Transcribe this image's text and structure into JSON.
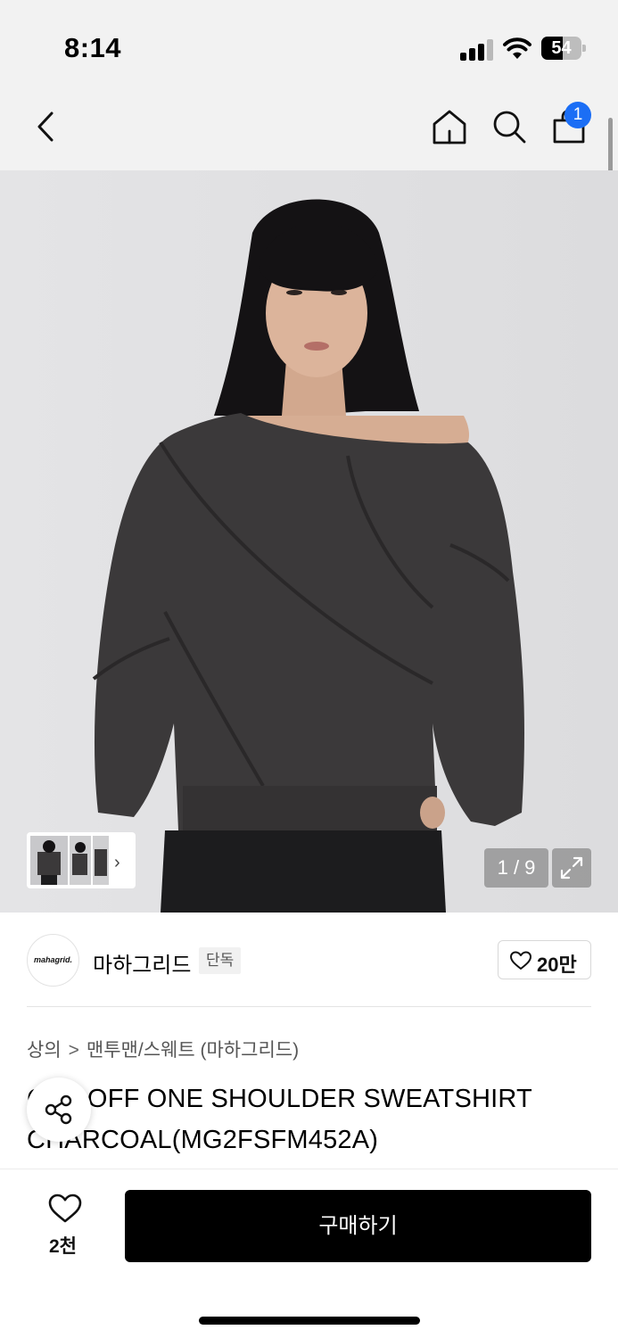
{
  "status_bar": {
    "time": "8:14",
    "battery_percent": "54",
    "battery_level": 0.54,
    "signal_bars": 3
  },
  "nav": {
    "back_icon": "chevron-left-icon",
    "home_icon": "home-icon",
    "search_icon": "search-icon",
    "cart_icon": "shopping-bag-icon",
    "cart_count": "1"
  },
  "gallery": {
    "counter": "1 / 9",
    "thumbnail_arrow": "›",
    "expand_icon": "expand-icon"
  },
  "brand": {
    "logo_text": "mahagrid.",
    "name": "마하그리드",
    "tag": "단독",
    "like_count": "20만"
  },
  "product": {
    "breadcrumb": [
      "상의",
      "맨투맨/스웨트 (마하그리드)"
    ],
    "title": "CUT OFF ONE SHOULDER SWEATSHIRT CHARCOAL(MG2FSFM452A)"
  },
  "bottom_bar": {
    "wish_count": "2천",
    "buy_label": "구매하기"
  },
  "colors": {
    "accent_badge": "#1b6ef5",
    "buy_button": "#000000",
    "garment": "#3b393a"
  }
}
